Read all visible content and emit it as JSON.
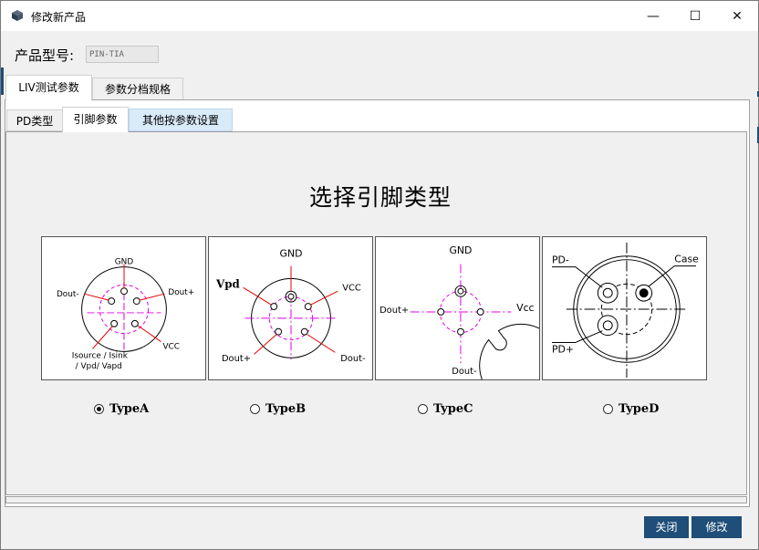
{
  "window": {
    "title": "修改新产品",
    "minimize_glyph": "—",
    "maximize_glyph": "☐",
    "close_glyph": "✕"
  },
  "product": {
    "model_label": "产品型号:",
    "model_value": "PIN-TIA"
  },
  "outer_tabs": [
    {
      "label": "LIV测试参数",
      "selected": true
    },
    {
      "label": "参数分档规格",
      "selected": false
    }
  ],
  "inner_tabs": [
    {
      "label": "PD类型",
      "selected": false
    },
    {
      "label": "引脚参数",
      "selected": true
    },
    {
      "label": "其他按参数设置",
      "selected": false
    }
  ],
  "heading": "选择引脚类型",
  "pin_types": [
    {
      "option": "TypeA",
      "selected": true,
      "labels": {
        "gnd": "GND",
        "dout_minus": "Dout-",
        "dout_plus": "Dout+",
        "vcc": "VCC",
        "isource": "Isource / Isink",
        "vpd": "/ Vpd/ Vapd"
      }
    },
    {
      "option": "TypeB",
      "selected": false,
      "labels": {
        "gnd": "GND",
        "vpd": "Vpd",
        "vcc": "VCC",
        "dout_plus": "Dout+",
        "dout_minus": "Dout-"
      }
    },
    {
      "option": "TypeC",
      "selected": false,
      "labels": {
        "gnd": "GND",
        "dout_plus": "Dout+",
        "vcc": "Vcc",
        "dout_minus": "Dout-"
      }
    },
    {
      "option": "TypeD",
      "selected": false,
      "labels": {
        "pd_minus": "PD-",
        "case": "Case",
        "pd_plus": "PD+"
      }
    }
  ],
  "buttons": {
    "close": "关闭",
    "modify": "修改"
  },
  "colors": {
    "accent_button": "#1f4e79",
    "selected_tab": "#d9ebf9",
    "pin_magenta": "#e000e0",
    "lead_red": "#e60000"
  },
  "icons": {
    "app": "package-cube-icon",
    "radio": "radio-button-icon"
  }
}
